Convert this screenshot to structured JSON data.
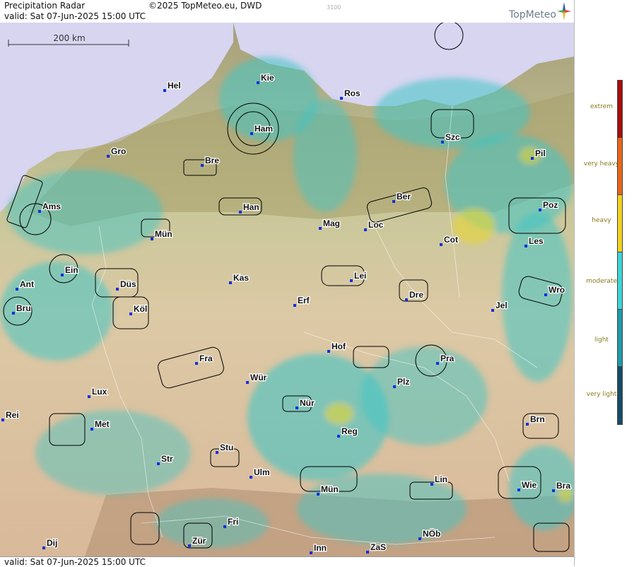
{
  "header": {
    "title": "Precipitation Radar",
    "copyright": "©2025 TopMeteo.eu, DWD",
    "valid": "valid:  Sat  07-Jun-2025 15:00 UTC",
    "code": "3100",
    "logo": "TopMeteo"
  },
  "footer": {
    "valid": "valid:  Sat  07-Jun-2025 15:00 UTC"
  },
  "scale_bar": {
    "label": "200 km"
  },
  "legend": {
    "levels": [
      {
        "label": "extrem",
        "color": "#a50e0e"
      },
      {
        "label": "very heavy",
        "color": "#e8661a"
      },
      {
        "label": "heavy",
        "color": "#f2d21f"
      },
      {
        "label": "moderate",
        "color": "#3cd6d6"
      },
      {
        "label": "light",
        "color": "#1f9aa8"
      },
      {
        "label": "very light",
        "color": "#164c66"
      }
    ]
  },
  "cities": [
    "Hel",
    "Kie",
    "Ros",
    "Ham",
    "Szc",
    "Gro",
    "Bre",
    "Pil",
    "Ams",
    "Han",
    "Ber",
    "Poz",
    "Mag",
    "Loc",
    "Mün",
    "Cot",
    "Les",
    "Ein",
    "Kas",
    "Lei",
    "Ant",
    "Düs",
    "Wro",
    "Dre",
    "Erf",
    "Bru",
    "Köl",
    "Jel",
    "Hof",
    "Fra",
    "Pra",
    "Wür",
    "Plz",
    "Lux",
    "Nür",
    "Rei",
    "Met",
    "Reg",
    "Brn",
    "Stu",
    "Str",
    "Ulm",
    "Lin",
    "Mün",
    "Wie",
    "Bra",
    "Fri",
    "NÖb",
    "Zür",
    "Dij",
    "Inn",
    "ZaS"
  ]
}
